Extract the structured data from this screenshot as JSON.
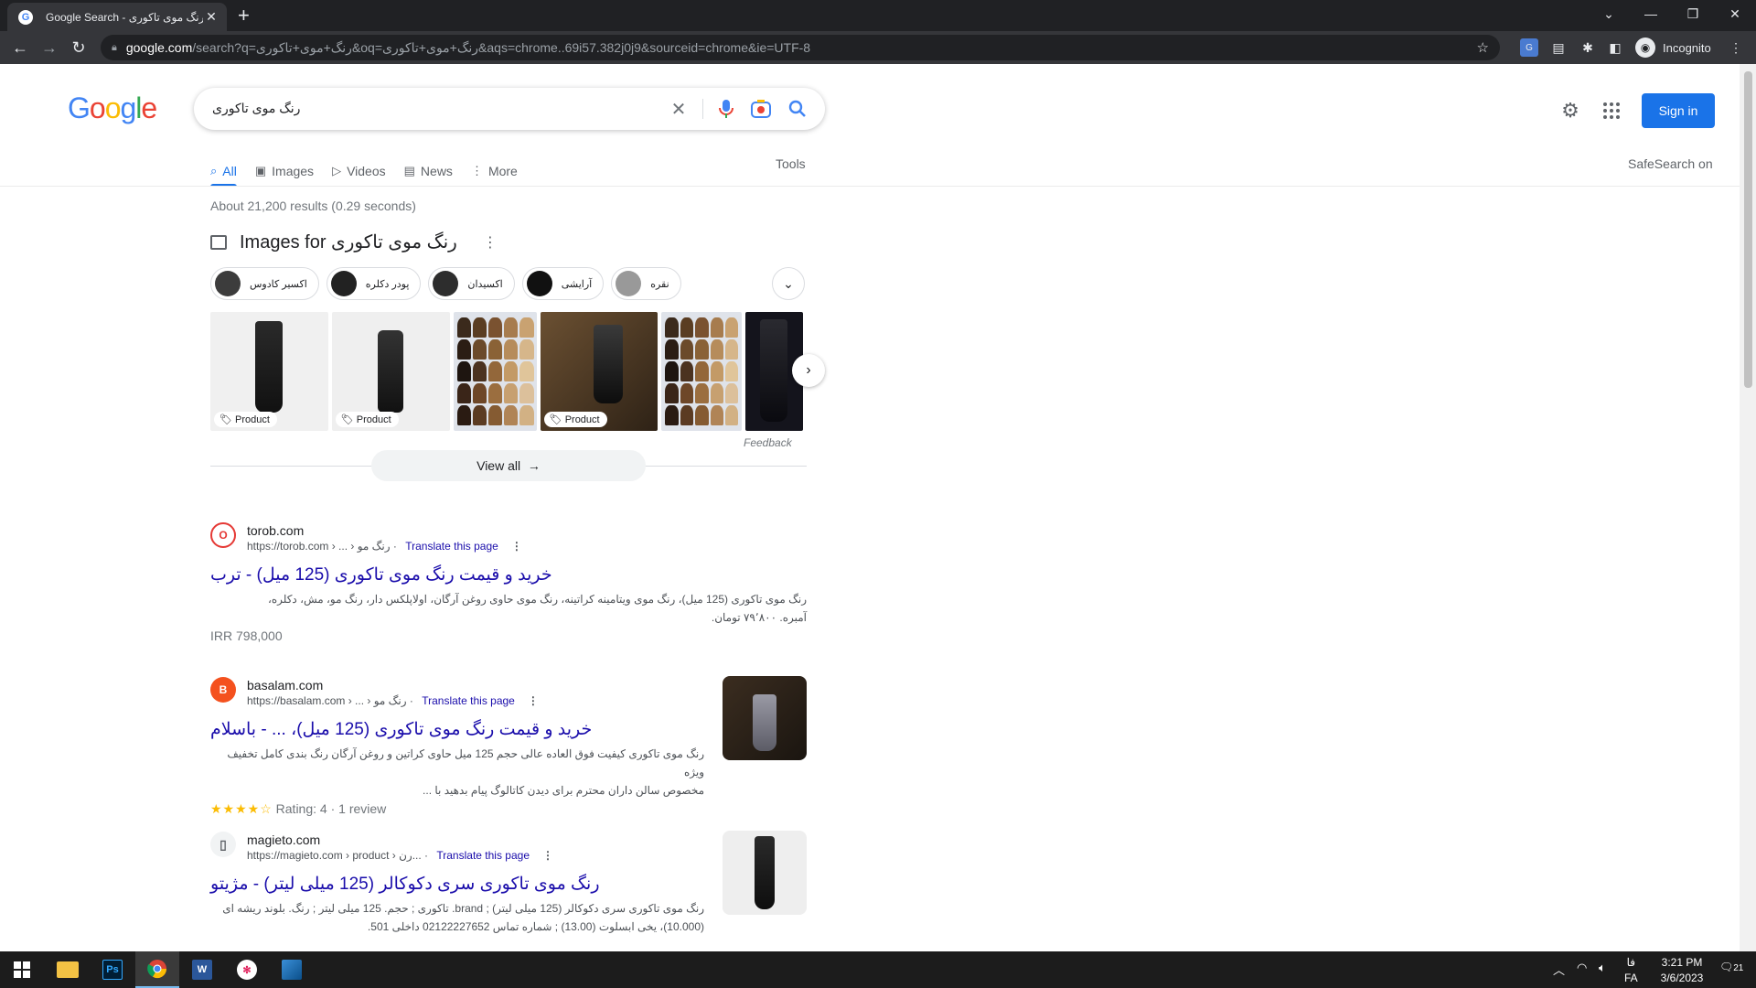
{
  "browser": {
    "tab_title": "Google Search - رنگ موی تاکوری",
    "url_host": "google.com",
    "url_rest": "/search?q=رنگ+موی+تاکوری&oq=رنگ+موی+تاکوری&aqs=chrome..69i57.382j0j9&sourceid=chrome&ie=UTF-8",
    "profile_label": "Incognito"
  },
  "header": {
    "logo": "Google",
    "query": "رنگ موی تاکوری",
    "signin_label": "Sign in",
    "tabs": [
      {
        "label": "All",
        "icon": "search-icon"
      },
      {
        "label": "Images",
        "icon": "image-icon"
      },
      {
        "label": "Videos",
        "icon": "video-icon"
      },
      {
        "label": "News",
        "icon": "news-icon"
      },
      {
        "label": "More",
        "icon": "more-vert-icon"
      }
    ],
    "tools_label": "Tools",
    "safesearch_label": "SafeSearch on"
  },
  "stats": "About 21,200 results (0.29 seconds)",
  "images": {
    "heading": "Images for رنگ موی تاکوری",
    "chips": [
      "اکسیر کادوس",
      "پودر دکلره",
      "اکسیدان",
      "آرایشی",
      "نقره"
    ],
    "product_tag": "Product",
    "feedback": "Feedback",
    "view_all": "View all"
  },
  "results": [
    {
      "site": "torob.com",
      "crumb": "https://torob.com › ... › رنگ مو",
      "translate": "Translate this page",
      "title": "خرید و قیمت رنگ موی تاکوری (125 میل) - ترب",
      "snippet1": "رنگ موی تاکوری (125 میل)، رنگ موی ویتامینه کراتینه، رنگ موی حاوی روغن آرگان، اولاپلکس دار، رنگ مو، مش، دکلره،",
      "snippet2": "آمبره. ۷۹٬۸۰۰ تومان.",
      "extra": "IRR 798,000"
    },
    {
      "site": "basalam.com",
      "crumb": "https://basalam.com › ... › رنگ مو",
      "translate": "Translate this page",
      "title": "خرید و قیمت رنگ موی تاکوری (125 میل)، ... - باسلام",
      "snippet1": "رنگ موی تاکوری کیفیت فوق العاده عالی حجم 125 میل حاوی کراتین و روغن آرگان رنگ بندی کامل تخفیف ویژه",
      "snippet2": "مخصوص سالن داران محترم برای دیدن کاتالوگ پیام بدهید با ...",
      "stars": "★★★★☆",
      "rating": "Rating: 4",
      "reviews": "1 review"
    },
    {
      "site": "magieto.com",
      "crumb": "https://magieto.com › product › رن...",
      "translate": "Translate this page",
      "title": "رنگ موی تاکوری سری دکوکالر (125 میلی لیتر) - مژیتو",
      "snippet1": "رنگ موی تاکوری سری دکوکالر (125 میلی لیتر) ; brand. تاکوری ; حجم. 125 میلی لیتر ; رنگ. بلوند ریشه ای",
      "snippet2": "(10.000)، یخی ابسلوت (13.00) ; شماره تماس 02122227652 داخلی 501."
    }
  ],
  "taskbar": {
    "time": "3:21 PM",
    "date": "3/6/2023",
    "lang": "FA",
    "lang2": "فا",
    "notif_count": "21"
  }
}
